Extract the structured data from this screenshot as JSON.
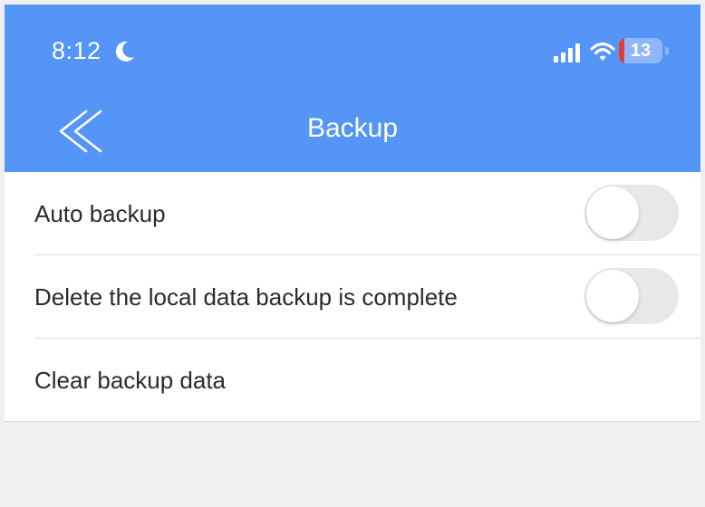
{
  "status_bar": {
    "time": "8:12",
    "battery": "13",
    "icons": [
      "moon-icon",
      "signal-icon",
      "wifi-icon",
      "battery-icon"
    ]
  },
  "nav": {
    "title": "Backup",
    "back_icon": "double-chevron-left-icon"
  },
  "settings": [
    {
      "label": "Auto backup",
      "toggle_on": false
    },
    {
      "label": "Delete the local data backup is complete",
      "toggle_on": false
    },
    {
      "label": "Clear backup data"
    }
  ],
  "colors": {
    "header": "#5595f8",
    "background": "#efefef",
    "battery_low": "#e23b3b"
  }
}
